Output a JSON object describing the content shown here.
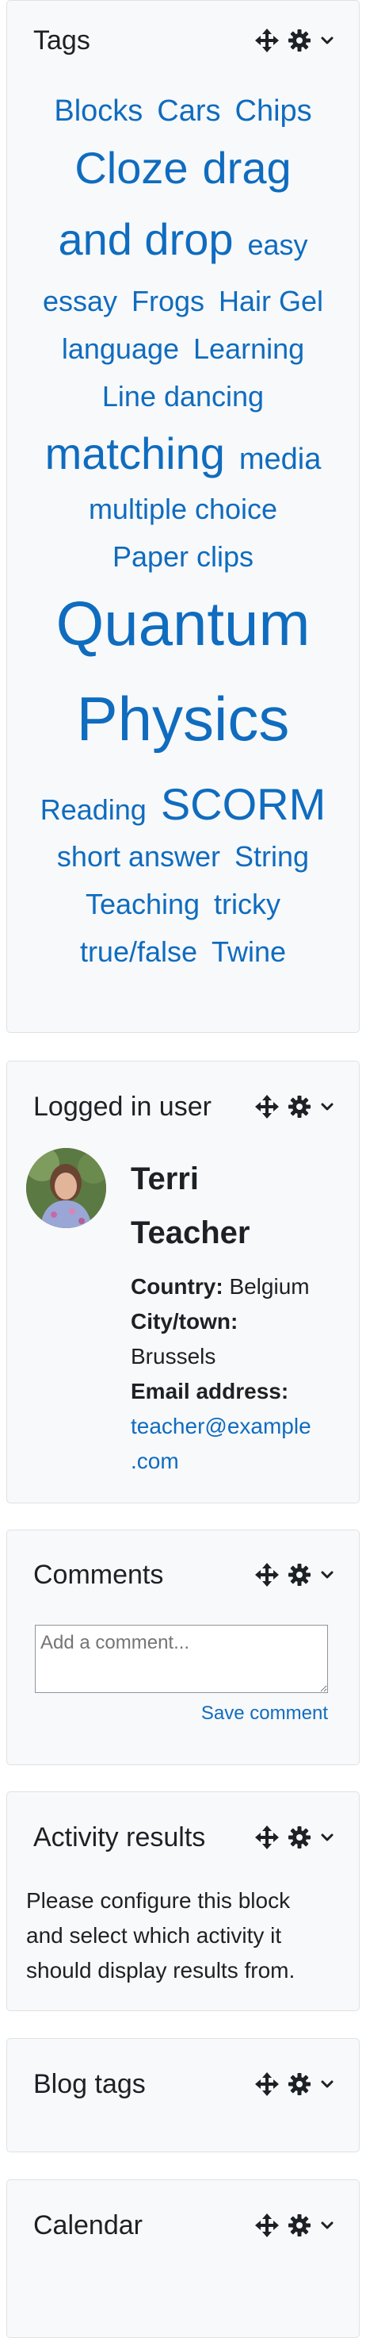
{
  "tags_block": {
    "title": "Tags",
    "lines": [
      [
        {
          "text": "Blocks",
          "size": 38
        },
        {
          "text": "Cars",
          "size": 38
        },
        {
          "text": "Chips",
          "size": 38
        }
      ],
      [
        {
          "text": "Cloze",
          "size": 56
        },
        {
          "text": "drag",
          "size": 56
        }
      ],
      [
        {
          "text": "and drop",
          "size": 56
        },
        {
          "text": "easy",
          "size": 36
        }
      ],
      [
        {
          "text": "essay",
          "size": 36
        },
        {
          "text": "Frogs",
          "size": 36
        },
        {
          "text": "Hair Gel",
          "size": 36
        }
      ],
      [
        {
          "text": "language",
          "size": 36
        },
        {
          "text": "Learning",
          "size": 36
        }
      ],
      [
        {
          "text": "Line dancing",
          "size": 36
        }
      ],
      [
        {
          "text": "matching",
          "size": 56
        },
        {
          "text": "media",
          "size": 38
        }
      ],
      [
        {
          "text": "multiple choice",
          "size": 36
        }
      ],
      [
        {
          "text": "Paper clips",
          "size": 36
        }
      ],
      [
        {
          "text": "Quantum",
          "size": 78
        }
      ],
      [
        {
          "text": "Physics",
          "size": 78
        }
      ],
      [
        {
          "text": "Reading",
          "size": 36
        },
        {
          "text": "SCORM",
          "size": 56
        }
      ],
      [
        {
          "text": "short answer",
          "size": 36
        },
        {
          "text": "String",
          "size": 36
        }
      ],
      [
        {
          "text": "Teaching",
          "size": 36
        },
        {
          "text": "tricky",
          "size": 36
        }
      ],
      [
        {
          "text": "true/false",
          "size": 36
        },
        {
          "text": "Twine",
          "size": 36
        }
      ]
    ]
  },
  "user_block": {
    "title": "Logged in user",
    "name_line1": "Terri",
    "name_line2": "Teacher",
    "country_label": "Country:",
    "country_value": "Belgium",
    "city_label": "City/town:",
    "city_value": "Brussels",
    "email_label": "Email address:",
    "email_line1": "teacher@example",
    "email_line2": ".com"
  },
  "comments_block": {
    "title": "Comments",
    "placeholder": "Add a comment...",
    "save_label": "Save comment"
  },
  "activity_block": {
    "title": "Activity results",
    "line1": "Please configure this block",
    "line2": "and select which activity it",
    "line3": "should display results from."
  },
  "blog_tags_block": {
    "title": "Blog tags"
  },
  "calendar_block": {
    "title": "Calendar"
  },
  "icons": {
    "move": "move-icon",
    "actions": "gear-icon",
    "collapse": "chevron-down-icon"
  },
  "colors": {
    "link": "#0f6cbf",
    "text": "#1d2125",
    "block_bg": "#f8f9fa",
    "border": "#dee2e6"
  }
}
